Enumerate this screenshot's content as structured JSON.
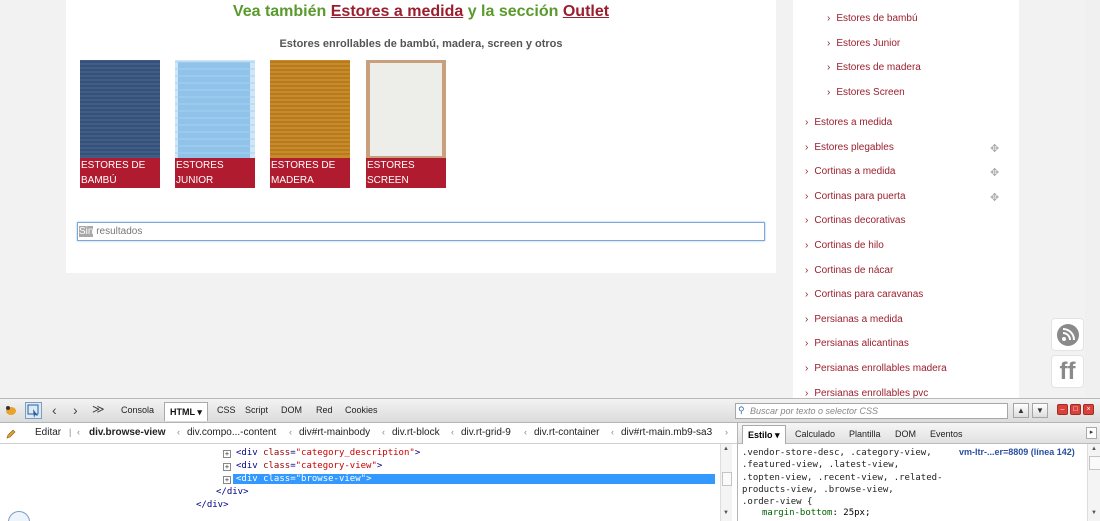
{
  "page": {
    "headline": {
      "part1": "Vea también ",
      "link1": "Estores a medida",
      "part2": " y  la sección ",
      "link2": "Outlet"
    },
    "subheading": "Estores enrollables de bambú, madera, screen y otros",
    "categories": [
      {
        "line1": "ESTORES DE",
        "line2": "BAMBÚ",
        "color": "#3f5d86"
      },
      {
        "line1": "ESTORES",
        "line2": "JUNIOR",
        "color": "#8fc3ea"
      },
      {
        "line1": "ESTORES DE",
        "line2": "MADERA",
        "color": "#c98a28"
      },
      {
        "line1": "ESTORES",
        "line2": "SCREEN",
        "color": "#ededea"
      }
    ],
    "search_value_selected": "Sin",
    "search_value_rest": " resultados"
  },
  "sidebar": {
    "subitems": [
      "Estores de bambú",
      "Estores Junior",
      "Estores de madera",
      "Estores Screen"
    ],
    "items": [
      {
        "label": "Estores a medida",
        "expandable": false
      },
      {
        "label": "Estores plegables",
        "expandable": true
      },
      {
        "label": "Cortinas a medida",
        "expandable": true
      },
      {
        "label": "Cortinas para puerta",
        "expandable": true
      },
      {
        "label": "Cortinas decorativas",
        "expandable": false
      },
      {
        "label": "Cortinas de hilo",
        "expandable": false
      },
      {
        "label": "Cortinas de nácar",
        "expandable": false
      },
      {
        "label": "Cortinas para caravanas",
        "expandable": false
      },
      {
        "label": "Persianas a medida",
        "expandable": false
      },
      {
        "label": "Persianas alicantinas",
        "expandable": false
      },
      {
        "label": "Persianas enrollables madera",
        "expandable": false
      },
      {
        "label": "Persianas enrollables pvc",
        "expandable": false
      }
    ],
    "chevron": "›",
    "expand_glyph": "✥"
  },
  "float_icons": [
    "rss-icon",
    "friendfeed-icon"
  ],
  "float_ff_text": "ff",
  "devtools": {
    "toolbar": {
      "console": "Consola",
      "html": "HTML ▾",
      "css": "CSS",
      "script": "Script",
      "dom": "DOM",
      "net": "Red",
      "cookies": "Cookies",
      "search_placeholder": "Buscar por texto o selector CSS"
    },
    "breadcrumbs": {
      "edit": "Editar",
      "items": [
        "div.browse-view",
        "div.compo...-content",
        "div#rt-mainbody",
        "div.rt-block",
        "div.rt-grid-9",
        "div.rt-container",
        "div#rt-main.mb9-sa3"
      ]
    },
    "tree": [
      {
        "open": "<div ",
        "attr": "class",
        "val": "\"category_description\"",
        "close": ">",
        "expander": true,
        "selected": false
      },
      {
        "open": "<div ",
        "attr": "class",
        "val": "\"category-view\"",
        "close": ">",
        "expander": true,
        "selected": false
      },
      {
        "open": "<div ",
        "attr": "class",
        "val": "\"browse-view\"",
        "close": ">",
        "expander": true,
        "selected": true
      },
      {
        "open": "</div>",
        "attr": "",
        "val": "",
        "close": "",
        "expander": false,
        "selected": false
      },
      {
        "open": "</div>",
        "attr": "",
        "val": "",
        "close": "",
        "expander": false,
        "selected": false
      }
    ],
    "style_tabs": {
      "estilo": "Estilo ▾",
      "calculado": "Calculado",
      "plantilla": "Plantilla",
      "dom": "DOM",
      "eventos": "Eventos"
    },
    "css_source": "vm-ltr-...er=8809 (línea 142)",
    "css_selector_lines": [
      ".vendor-store-desc, .category-view,",
      ".featured-view, .latest-view,",
      ".topten-view, .recent-view, .related-",
      "products-view, .browse-view,",
      ".order-view {"
    ],
    "css_property": "margin-bottom",
    "css_value": "25px;"
  }
}
